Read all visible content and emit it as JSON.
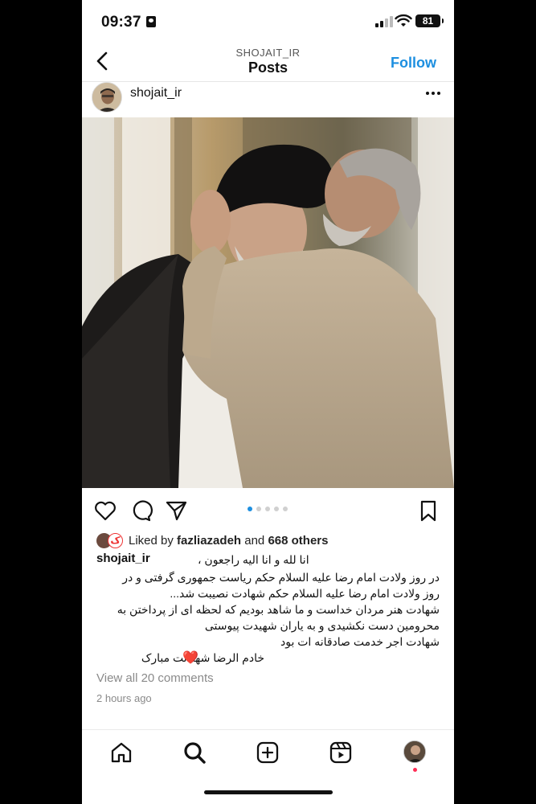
{
  "status_bar": {
    "time": "09:37",
    "battery": "81"
  },
  "header": {
    "account": "SHOJAIT_IR",
    "title": "Posts",
    "follow_label": "Follow"
  },
  "post": {
    "username": "shojait_ir",
    "carousel": {
      "total": 5,
      "active": 0
    },
    "likes": {
      "prefix": "Liked by",
      "liker": "fazliazadeh",
      "and": "and",
      "others": "668 others"
    },
    "caption_username": "shojait_ir",
    "caption_lines": [
      "انا لله و انا الیه راجعون ،",
      "در روز ولادت امام رضا علیه السلام حکم ریاست جمهوری گرفتی و در",
      "روز ولادت امام رضا علیه السلام حکم شهادت نصیبت شد...",
      "شهادت هنر مردان خداست و ما شاهد بودیم که لحظه ای از پرداختن به",
      "محرومین دست نکشیدی و به یاران شهیدت پیوستی",
      "شهادت اجر خدمت صادقانه ات بود",
      "خادم الرضا شهادتت مبارک"
    ],
    "heart_emoji": "❤️",
    "view_comments": "View all 20 comments",
    "time_ago": "2 hours ago"
  },
  "bottom_nav": {
    "items": [
      "home",
      "search",
      "create",
      "reels",
      "profile"
    ],
    "active": "search"
  },
  "colors": {
    "accent": "#1d8fe0",
    "muted": "#8a8a8a",
    "notification": "#ff2d55"
  }
}
